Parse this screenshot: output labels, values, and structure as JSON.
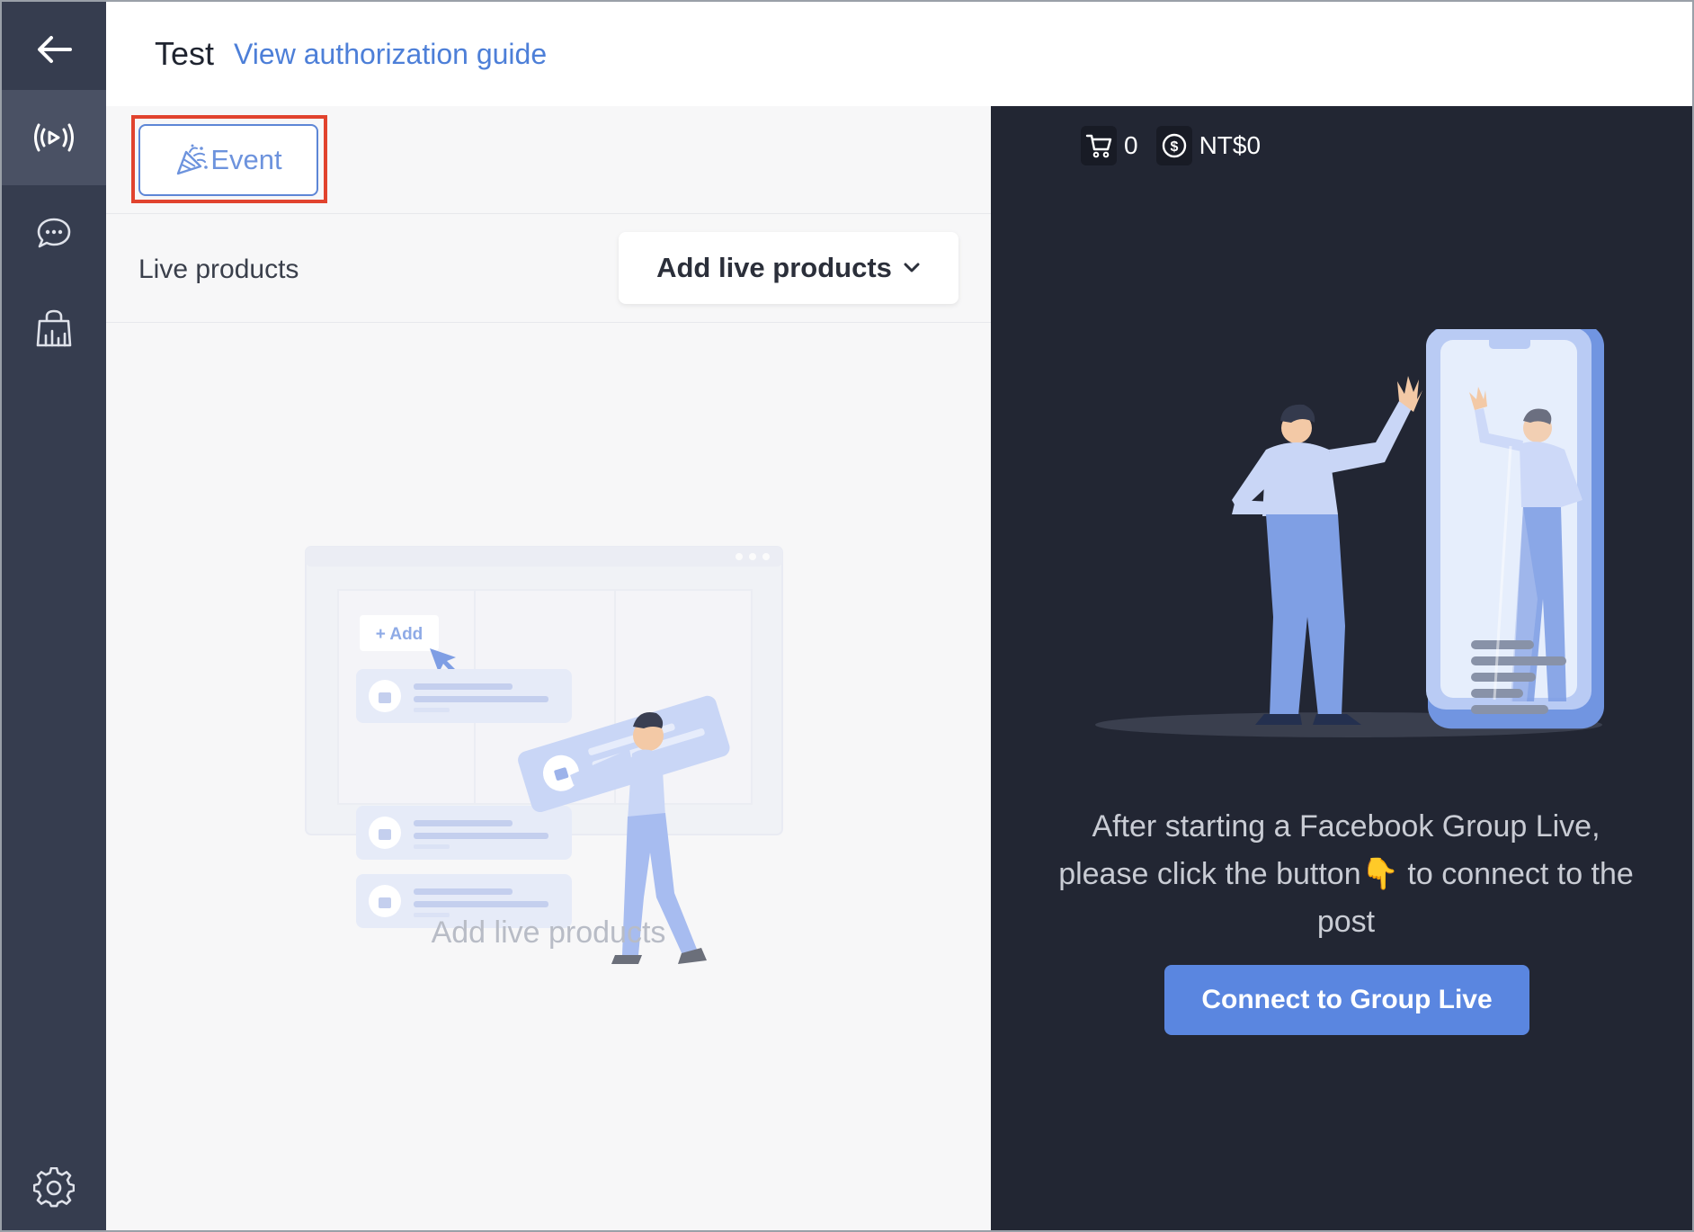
{
  "header": {
    "title": "Test",
    "guide_link": "View authorization guide"
  },
  "sidebar": {
    "items": [
      {
        "icon": "back-arrow-icon"
      },
      {
        "icon": "live-broadcast-icon",
        "active": true
      },
      {
        "icon": "chat-icon"
      },
      {
        "icon": "shop-icon"
      },
      {
        "icon": "gear-icon"
      }
    ]
  },
  "left_panel": {
    "event_button": "Event",
    "products_label": "Live products",
    "add_products_button": "Add live products",
    "illustration_add_label": "+ Add",
    "empty_state_label": "Add live products"
  },
  "right_panel": {
    "cart_count": "0",
    "revenue": "NT$0",
    "message_before_emoji": "After starting a Facebook Group Live, please click the button",
    "message_emoji": "👇",
    "message_after_emoji": " to connect to the post",
    "connect_button": "Connect to Group Live"
  },
  "colors": {
    "sidebar_bg": "#363d4f",
    "sidebar_active": "#4a5164",
    "right_panel_bg": "#222633",
    "accent_blue": "#5a86e0",
    "link_blue": "#4d7fd8",
    "highlight_red": "#e1432e"
  }
}
